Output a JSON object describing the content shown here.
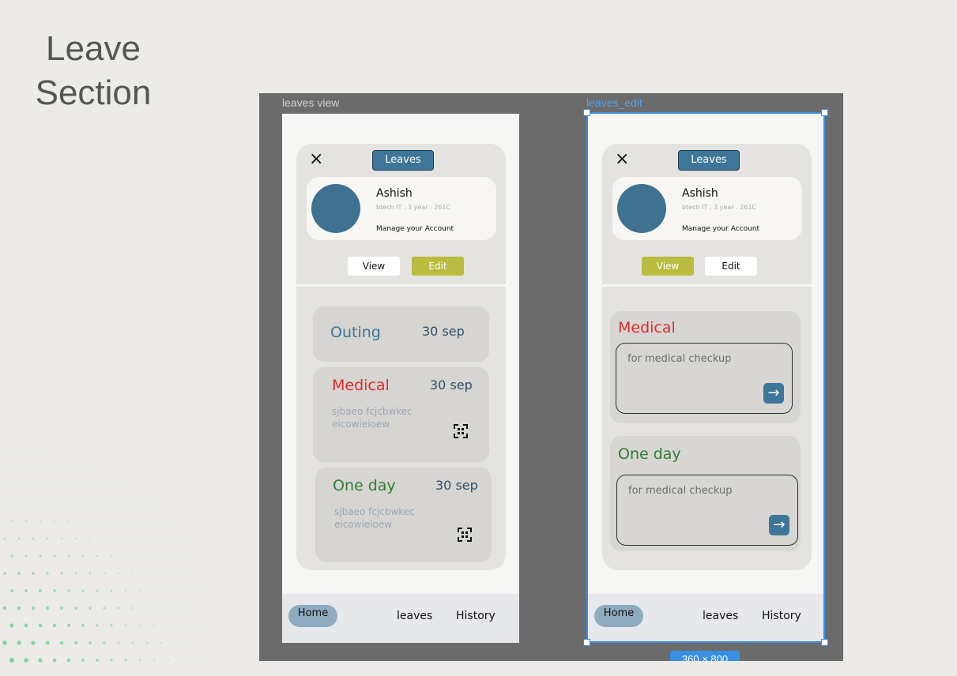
{
  "slide": {
    "title_line1": "Leave",
    "title_line2": "Section"
  },
  "frames": {
    "view": {
      "label": "leaves view",
      "close_icon": "×",
      "title": "Leaves",
      "profile": {
        "name": "Ashish",
        "details": "btech IT  .  3 year  .  261C",
        "manage": "Manage your Account"
      },
      "toggle": {
        "view_label": "View",
        "edit_label": "Edit",
        "active": "Edit"
      },
      "leaves": [
        {
          "type": "Outing",
          "date": "30 sep",
          "description": ""
        },
        {
          "type": "Medical",
          "date": "30 sep",
          "description": "sjbaeo fcjcbwkec eicowieioew"
        },
        {
          "type": "One day",
          "date": "30 sep",
          "description": "sjbaeo fcjcbwkec eicowieioew"
        }
      ],
      "nav": {
        "home": "Home",
        "leaves": "leaves",
        "history": "History"
      }
    },
    "edit": {
      "label": "leaves_edit",
      "close_icon": "×",
      "title": "Leaves",
      "profile": {
        "name": "Ashish",
        "details": "btech IT  .  3 year  .  261C",
        "manage": "Manage your Account"
      },
      "toggle": {
        "view_label": "View",
        "edit_label": "Edit",
        "active": "View"
      },
      "forms": [
        {
          "type": "Medical",
          "reason_text": "for medical checkup",
          "submit_icon": "→"
        },
        {
          "type": "One day",
          "reason_text": "for medical checkup",
          "submit_icon": "→"
        }
      ],
      "nav": {
        "home": "Home",
        "leaves": "leaves",
        "history": "History"
      },
      "size_badge": "360 × 800"
    }
  },
  "colors": {
    "primary": "#3d7698",
    "accent": "#b9bc3f",
    "outing": "#3d7698",
    "medical": "#e02a2a",
    "one_day": "#2e7d32",
    "selection": "#3a8ee6"
  }
}
